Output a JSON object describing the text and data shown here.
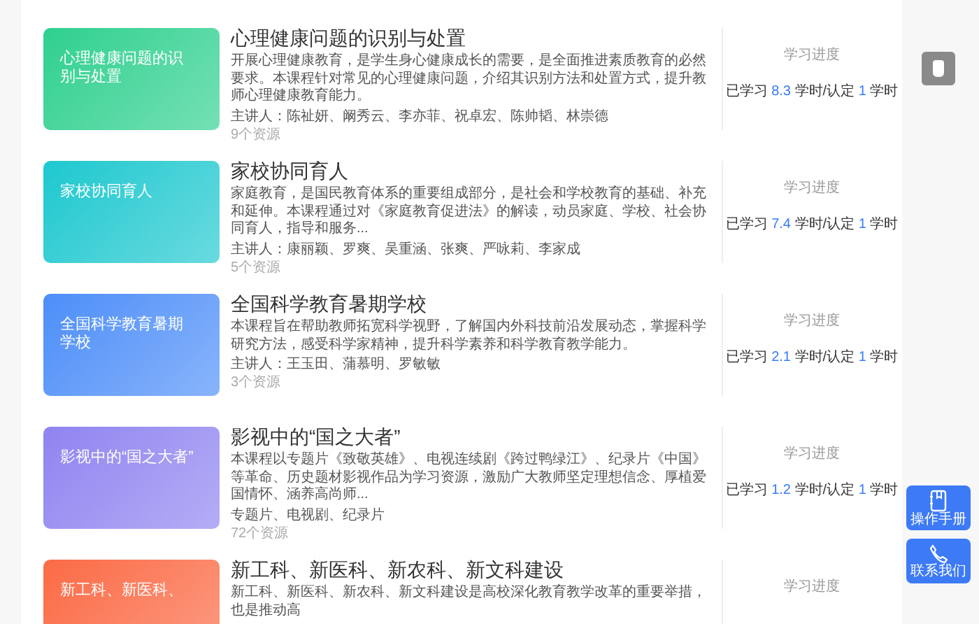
{
  "courses": [
    {
      "cover_title": "心理健康问题的识别与处置",
      "color": "#2fd08f",
      "title": "心理健康问题的识别与处置",
      "description": "开展心理健康教育，是学生身心健康成长的需要，是全面推进素质教育的必然要求。本课程针对常见的心理健康问题，介绍其识别方法和处置方式，提升教师心理健康教育能力。",
      "meta": "主讲人：陈祉妍、阚秀云、李亦菲、祝卓宏、陈帅韬、林崇德",
      "resources": "9个资源",
      "progress_label": "学习进度",
      "studied_label": "已学习",
      "studied": "8.3",
      "middle": "学时/认定",
      "certified": "1",
      "unit": "学时"
    },
    {
      "cover_title": "家校协同育人",
      "color": "#1ec8cf",
      "title": "家校协同育人",
      "description": "家庭教育，是国民教育体系的重要组成部分，是社会和学校教育的基础、补充和延伸。本课程通过对《家庭教育促进法》的解读，动员家庭、学校、社会协同育人，指导和服务...",
      "meta": "主讲人：康丽颖、罗爽、吴重涵、张爽、严咏莉、李家成",
      "resources": "5个资源",
      "progress_label": "学习进度",
      "studied_label": "已学习",
      "studied": "7.4",
      "middle": "学时/认定",
      "certified": "1",
      "unit": "学时"
    },
    {
      "cover_title": "全国科学教育暑期学校",
      "color": "#4d8ef8",
      "title": "全国科学教育暑期学校",
      "description": "本课程旨在帮助教师拓宽科学视野，了解国内外科技前沿发展动态，掌握科学研究方法，感受科学家精神，提升科学素养和科学教育教学能力。",
      "meta": "主讲人：王玉田、蒲慕明、罗敏敏",
      "resources": "3个资源",
      "progress_label": "学习进度",
      "studied_label": "已学习",
      "studied": "2.1",
      "middle": "学时/认定",
      "certified": "1",
      "unit": "学时"
    },
    {
      "cover_title": "影视中的“国之大者”",
      "color": "#8f84f0",
      "title": "影视中的“国之大者”",
      "description": "本课程以专题片《致敬英雄》、电视连续剧《跨过鸭绿江》、纪录片《中国》等革命、历史题材影视作品为学习资源，激励广大教师坚定理想信念、厚植爱国情怀、涵养高尚师...",
      "meta": "专题片、电视剧、纪录片",
      "resources": "72个资源",
      "progress_label": "学习进度",
      "studied_label": "已学习",
      "studied": "1.2",
      "middle": "学时/认定",
      "certified": "1",
      "unit": "学时"
    },
    {
      "cover_title": "新工科、新医科、",
      "color": "#fb6a45",
      "title": "新工科、新医科、新农科、新文科建设",
      "description": "新工科、新医科、新农科、新文科建设是高校深化教育教学改革的重要举措，也是推动高",
      "progress_label": "学习进度"
    }
  ],
  "side_buttons": [
    {
      "label": "操作手册",
      "kind": "manual"
    },
    {
      "label": "联系我们",
      "kind": "contact"
    }
  ]
}
